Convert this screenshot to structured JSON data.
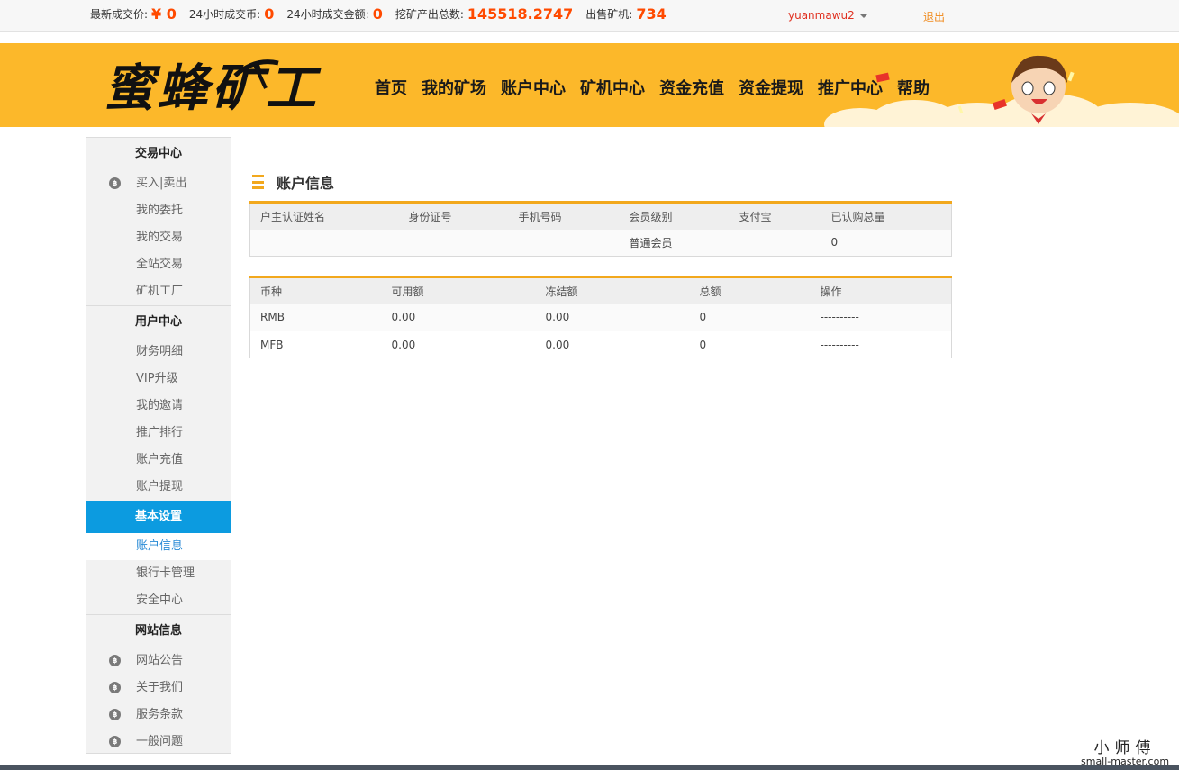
{
  "stats": [
    {
      "label": "最新成交价:",
      "value": "¥ 0"
    },
    {
      "label": "24小时成交币:",
      "value": "0"
    },
    {
      "label": "24小时成交金额:",
      "value": "0"
    },
    {
      "label": "挖矿产出总数:",
      "value": "145518.2747"
    },
    {
      "label": "出售矿机:",
      "value": "734"
    }
  ],
  "user": {
    "name": "yuanmawu2",
    "logout": "退出"
  },
  "logo": {
    "text": "蜜蜂矿工"
  },
  "nav": [
    "首页",
    "我的矿场",
    "账户中心",
    "矿机中心",
    "资金充值",
    "资金提现",
    "推广中心",
    "帮助"
  ],
  "sidebar": {
    "trade": {
      "title": "交易中心",
      "items": [
        "买入|卖出",
        "我的委托",
        "我的交易",
        "全站交易",
        "矿机工厂"
      ]
    },
    "user": {
      "title": "用户中心",
      "items": [
        "财务明细",
        "VIP升级",
        "我的邀请",
        "推广排行",
        "账户充值",
        "账户提现"
      ]
    },
    "basic": {
      "title": "基本设置",
      "items": [
        "账户信息",
        "银行卡管理",
        "安全中心"
      ]
    },
    "site": {
      "title": "网站信息",
      "items": [
        "网站公告",
        "关于我们",
        "服务条款",
        "一般问题"
      ]
    }
  },
  "page_title": "账户信息",
  "account_table": {
    "headers": [
      "户主认证姓名",
      "身份证号",
      "手机号码",
      "会员级别",
      "支付宝",
      "已认购总量"
    ],
    "row": [
      "",
      "",
      "",
      "普通会员",
      "",
      "0"
    ]
  },
  "wallet_table": {
    "headers": [
      "币种",
      "可用额",
      "冻结额",
      "总额",
      "操作"
    ],
    "rows": [
      [
        "RMB",
        "0.00",
        "0.00",
        "0",
        "----------"
      ],
      [
        "MFB",
        "0.00",
        "0.00",
        "0",
        "----------"
      ]
    ]
  },
  "watermark": {
    "cn": "小师傅",
    "en": "small-master.com"
  },
  "colors": {
    "accent": "#fcb82a",
    "active": "#0c9be0",
    "highlight": "#ff4a00",
    "border": "#f2a81d"
  }
}
